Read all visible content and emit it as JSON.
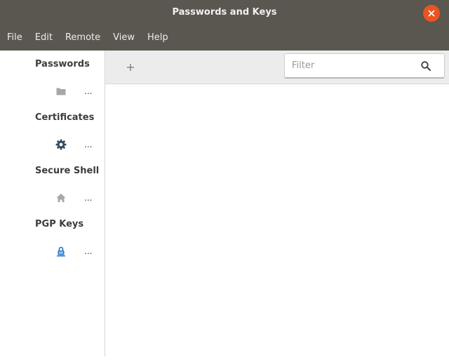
{
  "window": {
    "title": "Passwords and Keys"
  },
  "menubar": {
    "items": [
      "File",
      "Edit",
      "Remote",
      "View",
      "Help"
    ]
  },
  "sidebar": {
    "sections": [
      {
        "heading": "Passwords",
        "icon": "folder-icon",
        "row_label": "..."
      },
      {
        "heading": "Certificates",
        "icon": "gear-icon",
        "row_label": "..."
      },
      {
        "heading": "Secure Shell",
        "icon": "home-icon",
        "row_label": "..."
      },
      {
        "heading": "PGP Keys",
        "icon": "user-lock-icon",
        "row_label": "..."
      }
    ]
  },
  "toolbar": {
    "add_label": "+",
    "filter_placeholder": "Filter",
    "filter_value": ""
  },
  "colors": {
    "titlebar": "#5a5650",
    "close_button": "#e95420",
    "toolbar": "#ececec",
    "accent_blue": "#1c74c8"
  }
}
